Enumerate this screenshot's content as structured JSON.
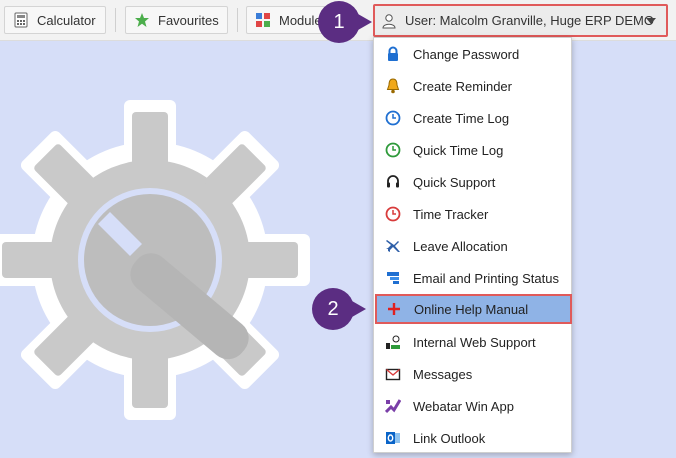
{
  "toolbar": {
    "calculator_label": "Calculator",
    "favourites_label": "Favourites",
    "modules_label": "Modules",
    "user_label": "User: Malcolm Granville, Huge ERP DEMO"
  },
  "menu": {
    "items": [
      {
        "label": "Change Password",
        "icon": "lock-icon"
      },
      {
        "label": "Create Reminder",
        "icon": "bell-icon"
      },
      {
        "label": "Create Time Log",
        "icon": "clock-icon"
      },
      {
        "label": "Quick Time Log",
        "icon": "clock-green-icon"
      },
      {
        "label": "Quick Support",
        "icon": "headset-icon"
      },
      {
        "label": "Time Tracker",
        "icon": "clock-red-icon"
      },
      {
        "label": "Leave Allocation",
        "icon": "plane-icon"
      },
      {
        "label": "Email and Printing Status",
        "icon": "status-icon"
      },
      {
        "label": "Online Help Manual",
        "icon": "plus-icon"
      },
      {
        "label": "Internal Web Support",
        "icon": "web-support-icon"
      },
      {
        "label": "Messages",
        "icon": "envelope-icon"
      },
      {
        "label": "Webatar Win App",
        "icon": "webatar-icon"
      },
      {
        "label": "Link Outlook",
        "icon": "outlook-icon"
      }
    ]
  },
  "callouts": {
    "one": "1",
    "two": "2"
  },
  "colors": {
    "highlight": "#8fb3e6",
    "callout": "#5b2d82",
    "outline": "#e05a5a"
  }
}
